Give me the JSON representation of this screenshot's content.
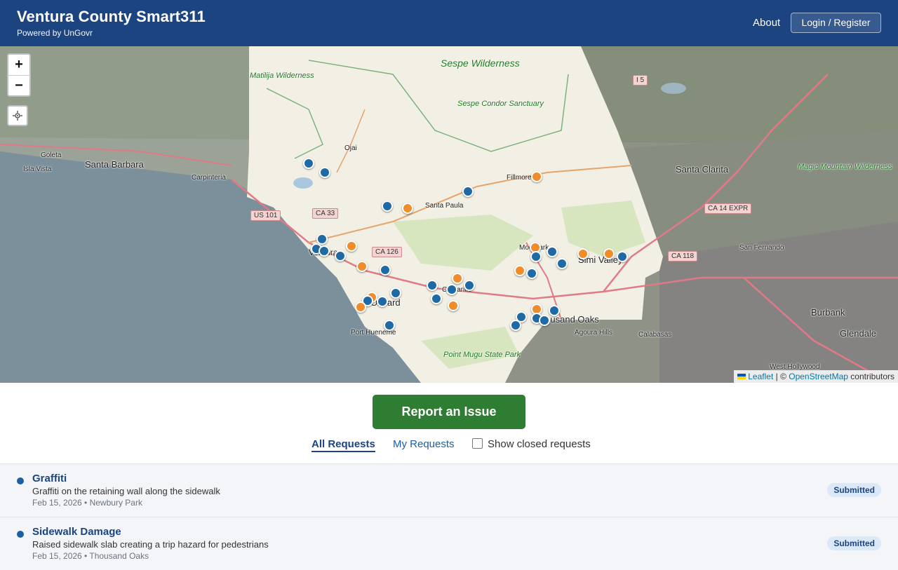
{
  "header": {
    "title": "Ventura County Smart311",
    "subtitle": "Powered by UnGovr",
    "about_label": "About",
    "login_label": "Login / Register"
  },
  "map": {
    "zoom_in": "+",
    "zoom_out": "−",
    "locate_icon": "crosshair-icon",
    "attribution": {
      "leaflet": "Leaflet",
      "sep": " | © ",
      "osm": "OpenStreetMap",
      "suffix": " contributors"
    },
    "labels": {
      "sespe": "Sespe Wilderness",
      "matilija": "Matilija Wilderness",
      "condor": "Sespe Condor Sanctuary",
      "goleta": "Goleta",
      "isla_vista": "Isla Vista",
      "santa_barbara": "Santa Barbara",
      "carpinteria": "Carpinteria",
      "ojai": "Ojai",
      "fillmore": "Fillmore",
      "santa_paula": "Santa Paula",
      "ventura": "Ventura",
      "moorpark": "Moorpark",
      "simi_valley": "Simi Valley",
      "oxnard": "Oxnard",
      "camarillo": "Camarillo",
      "port_hueneme": "Port Hueneme",
      "thousand_oaks": "Thousand Oaks",
      "agoura_hills": "Agoura Hills",
      "calabasas": "Calabasas",
      "point_mugu": "Point Mugu State Park",
      "santa_clarita": "Santa Clarita",
      "magic_mountain": "Magic Mountain Wilderness",
      "san_fernando": "San Fernando",
      "burbank": "Burbank",
      "glendale": "Glendale",
      "west_hollywood": "West Hollywood",
      "i5": "I 5",
      "us101": "US 101",
      "ca33": "CA 33",
      "ca126": "CA 126",
      "ca14": "CA 14 EXPR",
      "ca118": "CA 118"
    },
    "marker_colors": {
      "submitted": "#1f6aa5",
      "in_progress": "#f18c2a"
    }
  },
  "actions": {
    "report_label": "Report an Issue",
    "tab_all": "All Requests",
    "tab_mine": "My Requests",
    "show_closed": "Show closed requests"
  },
  "requests": [
    {
      "title": "Graffiti",
      "description": "Graffiti on the retaining wall along the sidewalk",
      "meta": "Feb 15, 2026 • Newbury Park",
      "status": "Submitted"
    },
    {
      "title": "Sidewalk Damage",
      "description": "Raised sidewalk slab creating a trip hazard for pedestrians",
      "meta": "Feb 15, 2026 • Thousand Oaks",
      "status": "Submitted"
    }
  ]
}
